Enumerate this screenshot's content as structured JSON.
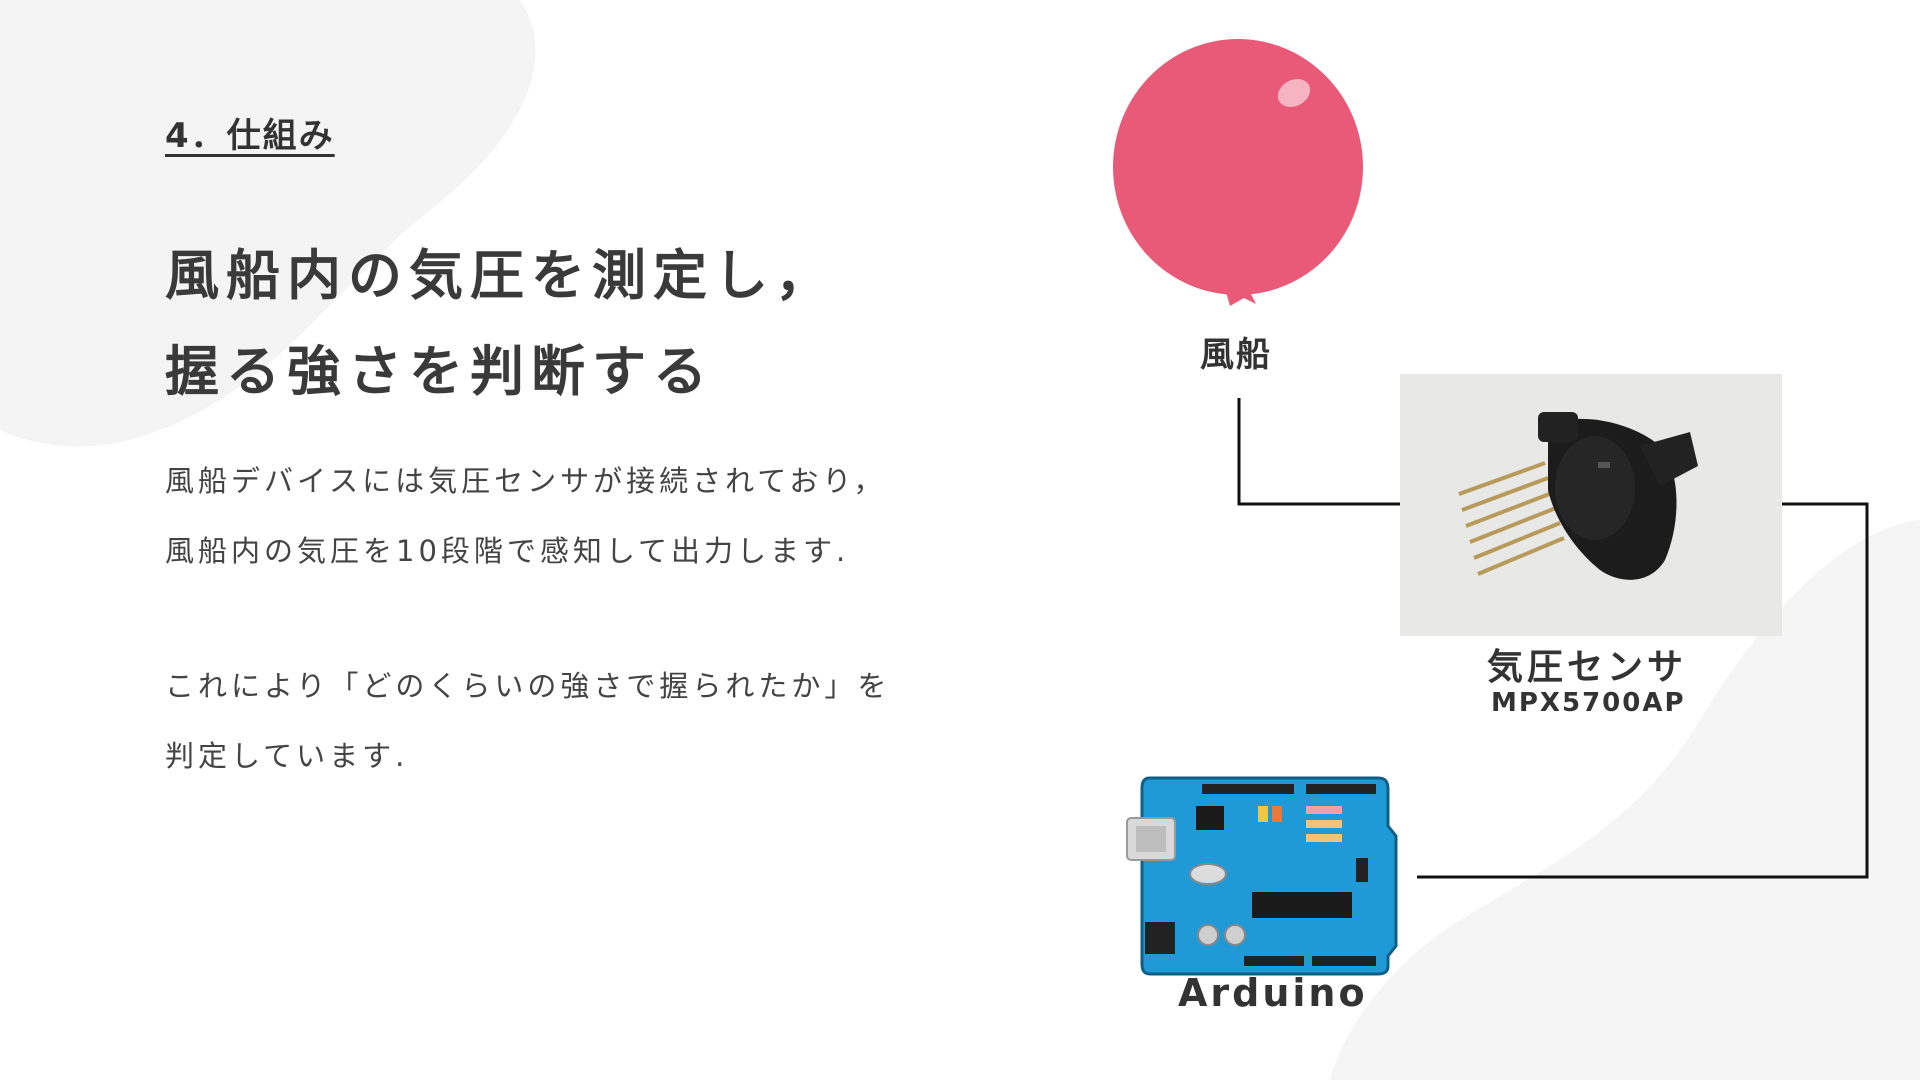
{
  "slide": {
    "section_label": "4．仕組み",
    "headline": {
      "line1": "風船内の気圧を測定し，",
      "line2": "握る強さを判断する"
    },
    "paragraph1": {
      "line1": "風船デバイスには気圧センサが接続されており，",
      "line2": "風船内の気圧を10段階で感知して出力します."
    },
    "paragraph2": {
      "line1": "これにより「どのくらいの強さで握られたか」を",
      "line2": "判定しています."
    }
  },
  "diagram": {
    "balloon": {
      "label": "風船",
      "color": "#e85a78",
      "icon": "balloon-icon"
    },
    "sensor": {
      "label": "気圧センサ",
      "model": "MPX5700AP",
      "icon": "pressure-sensor-photo"
    },
    "arduino": {
      "label": "Arduino",
      "color": "#1f9ad6",
      "icon": "arduino-board-icon"
    }
  },
  "colors": {
    "background": "#ffffff",
    "blob": "#f4f4f4",
    "text": "#333333",
    "wire": "#111111"
  }
}
